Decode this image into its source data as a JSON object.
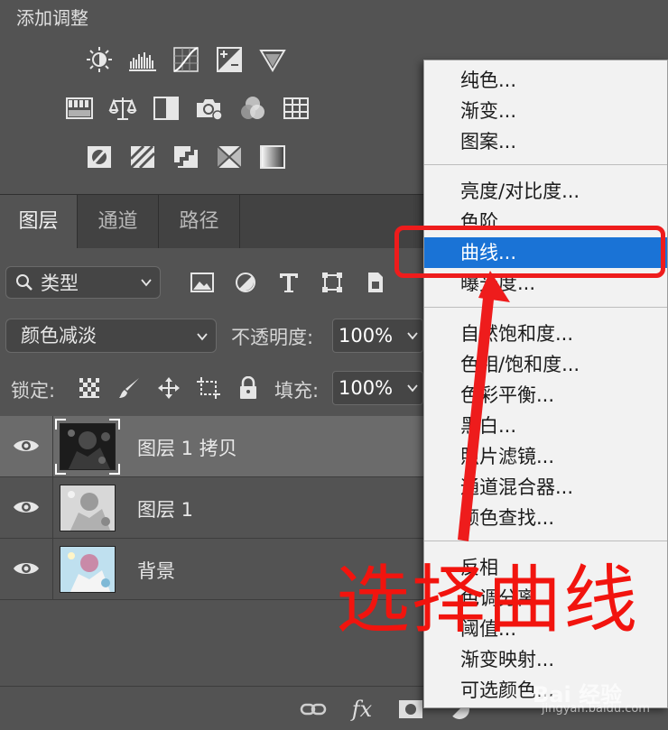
{
  "adjustments": {
    "title": "添加调整",
    "rows": [
      [
        "brightness-contrast-icon",
        "levels-icon",
        "curves-icon",
        "exposure-icon",
        "vibrance-icon"
      ],
      [
        "hue-saturation-icon",
        "color-balance-icon",
        "black-white-icon",
        "photo-filter-icon",
        "channel-mixer-icon",
        "color-lookup-icon"
      ],
      [
        "invert-icon",
        "posterize-icon",
        "threshold-icon",
        "selective-color-icon",
        "gradient-map-icon"
      ]
    ]
  },
  "tabs": [
    "图层",
    "通道",
    "路径"
  ],
  "filter": {
    "selected": "类型"
  },
  "blend": {
    "mode": "颜色减淡",
    "opacity_label": "不透明度:",
    "opacity_value": "100%",
    "lock_label": "锁定:",
    "fill_label": "填充:",
    "fill_value": "100%"
  },
  "layers": [
    {
      "name": "图层 1 拷贝",
      "selected": true
    },
    {
      "name": "图层 1",
      "selected": false
    },
    {
      "name": "背景",
      "selected": false
    }
  ],
  "bottom_bar": {
    "fx_label": "fx"
  },
  "menu": {
    "items": [
      "纯色...",
      "渐变...",
      "图案...",
      "亮度/对比度...",
      "色阶...",
      "曲线...",
      "曝光度...",
      "自然饱和度...",
      "色相/饱和度...",
      "色彩平衡...",
      "黑白...",
      "照片滤镜...",
      "通道混合器...",
      "颜色查找...",
      "反相",
      "色调分离...",
      "阈值...",
      "渐变映射...",
      "可选颜色..."
    ],
    "highlighted": "曲线..."
  },
  "annotation": {
    "text": "选择曲线"
  },
  "watermark": {
    "text": "Bai 经验",
    "sub": "jingyan.baidu.com"
  },
  "colors": {
    "panel_bg": "#535353",
    "menu_bg": "#f2f2f2",
    "highlight": "#1a73d6",
    "annotation_red": "#ee1c1c"
  }
}
